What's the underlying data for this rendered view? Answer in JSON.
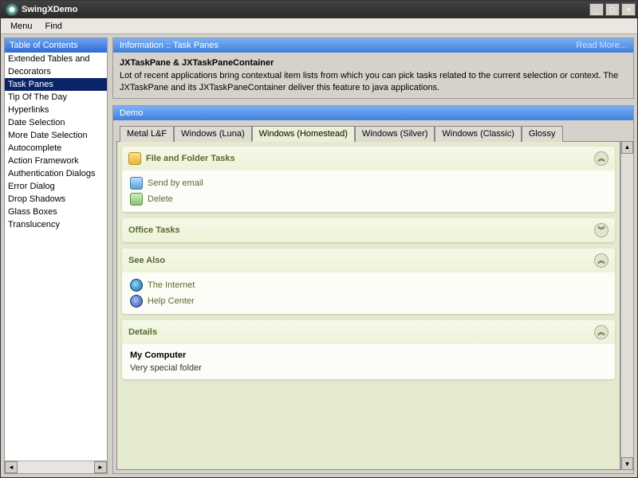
{
  "window": {
    "title": "SwingXDemo"
  },
  "menubar": {
    "items": [
      "Menu",
      "Find"
    ]
  },
  "sidebar": {
    "header": "Table of Contents",
    "items": [
      "Extended Tables and",
      "Decorators",
      "Task Panes",
      "Tip Of The Day",
      "Hyperlinks",
      "Date Selection",
      "More Date Selection",
      "Autocomplete",
      "Action Framework",
      "Authentication Dialogs",
      "Error Dialog",
      "Drop Shadows",
      "Glass Boxes",
      "Translucency"
    ],
    "selected_index": 2
  },
  "info_panel": {
    "header": "Information :: Task Panes",
    "read_more": "Read More...",
    "heading": "JXTaskPane & JXTaskPaneContainer",
    "body": "Lot of recent applications bring contextual item lists from which you can pick tasks related to the current selection or context. The JXTaskPane and its JXTaskPaneContainer deliver this feature to java applications."
  },
  "demo_panel": {
    "header": "Demo",
    "tabs": [
      "Metal L&F",
      "Windows (Luna)",
      "Windows (Homestead)",
      "Windows (Silver)",
      "Windows (Classic)",
      "Glossy"
    ],
    "active_tab": 2,
    "panes": {
      "file": {
        "title": "File and Folder Tasks",
        "links": [
          "Send by email",
          "Delete"
        ]
      },
      "office": {
        "title": "Office Tasks"
      },
      "seealso": {
        "title": "See Also",
        "links": [
          "The Internet",
          "Help Center"
        ]
      },
      "details": {
        "title": "Details",
        "line1": "My Computer",
        "line2": "Very special folder"
      }
    }
  }
}
